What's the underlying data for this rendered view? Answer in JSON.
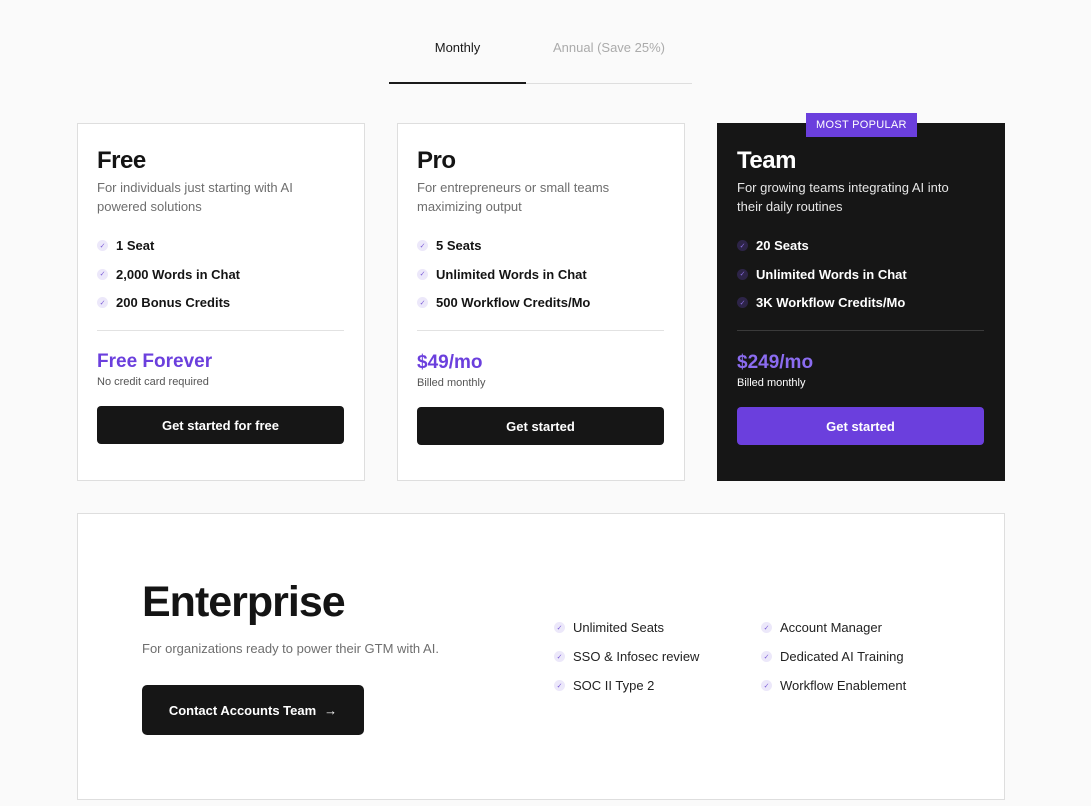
{
  "billing_tabs": [
    {
      "label": "Monthly",
      "active": true
    },
    {
      "label": "Annual (Save 25%)",
      "active": false
    }
  ],
  "plans": [
    {
      "name": "Free",
      "description": "For individuals just starting with AI powered solutions",
      "features": [
        "1 Seat",
        "2,000 Words in Chat",
        "200 Bonus Credits"
      ],
      "price": "Free Forever",
      "price_note": "No credit card required",
      "cta": "Get started for free"
    },
    {
      "name": "Pro",
      "description": "For entrepreneurs or small teams maximizing output",
      "features": [
        "5 Seats",
        "Unlimited Words in Chat",
        "500 Workflow Credits/Mo"
      ],
      "price": "$49/mo",
      "price_note": "Billed monthly",
      "cta": "Get started"
    },
    {
      "name": "Team",
      "badge": "MOST POPULAR",
      "description": "For growing teams integrating AI into their daily routines",
      "features": [
        "20 Seats",
        "Unlimited Words in Chat",
        "3K Workflow Credits/Mo"
      ],
      "price": "$249/mo",
      "price_note": "Billed monthly",
      "cta": "Get started"
    }
  ],
  "enterprise": {
    "title": "Enterprise",
    "description": "For organizations ready to power their GTM with AI.",
    "cta": "Contact Accounts Team",
    "cta_icon": "→",
    "features_col1": [
      "Unlimited Seats",
      "SSO & Infosec review",
      "SOC II Type 2"
    ],
    "features_col2": [
      "Account Manager",
      "Dedicated AI Training",
      "Workflow Enablement"
    ]
  },
  "icons": {
    "check": "✓",
    "arrow_right": "→"
  },
  "colors": {
    "accent": "#6b3fdd",
    "dark": "#161616",
    "background": "#fafafa"
  }
}
